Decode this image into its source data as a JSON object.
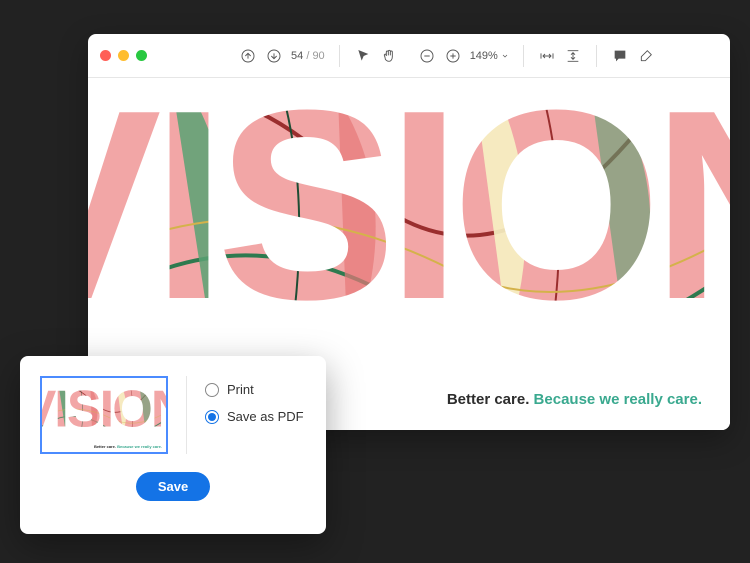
{
  "toolbar": {
    "page_current": "54",
    "page_separator": "/",
    "page_total": "90",
    "zoom": "149%"
  },
  "artwork": {
    "word": "VISION",
    "tagline_a": "Better care.",
    "tagline_b": "Because we really care."
  },
  "modal": {
    "option_print": "Print",
    "option_pdf": "Save as PDF",
    "save_label": "Save"
  },
  "colors": {
    "accent": "#1473e6",
    "teal": "#3aa98f"
  }
}
